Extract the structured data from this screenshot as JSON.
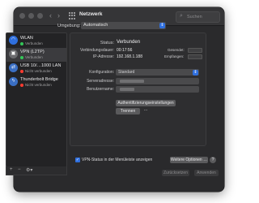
{
  "window": {
    "title": "Netzwerk",
    "search_placeholder": "Suchen"
  },
  "location": {
    "label": "Umgebung:",
    "value": "Automatisch"
  },
  "sidebar": {
    "items": [
      {
        "name": "WLAN",
        "status": "Verbunden",
        "status_color": "#34c759",
        "icon": "wifi-icon",
        "icon_color": "#2f6fde"
      },
      {
        "name": "VPN (L2TP)",
        "status": "Verbunden",
        "status_color": "#34c759",
        "icon": "lock-icon",
        "icon_color": "#6b6b6e"
      },
      {
        "name": "USB 10/…1000 LAN",
        "status": "Nicht verbunden",
        "status_color": "#ff3b30",
        "icon": "ethernet-icon",
        "icon_color": "#3a6fc4"
      },
      {
        "name": "Thunderbolt Bridge",
        "status": "Nicht verbunden",
        "status_color": "#ff3b30",
        "icon": "thunderbolt-icon",
        "icon_color": "#3a6fc4"
      }
    ],
    "add_label": "+",
    "remove_label": "−",
    "gear_label": "⚙︎▾"
  },
  "details": {
    "status_label": "Status:",
    "status_value": "Verbunden",
    "connect_time_label": "Verbindungsdauer:",
    "connect_time_value": "00:17:56",
    "ip_label": "IP-Adresse:",
    "ip_value": "192.168.1.188",
    "sent_label": "Gesendet:",
    "received_label": "Empfangen:",
    "config_label": "Konfiguration:",
    "config_value": "Standard",
    "server_label": "Serveradresse:",
    "server_value": "",
    "account_label": "Benutzername:",
    "account_value": "",
    "auth_button": "Authentifizierungseinstellungen …",
    "disconnect_button": "Trennen"
  },
  "footer": {
    "show_vpn_label": "VPN-Status in der Menüleiste anzeigen",
    "advanced_button": "Weitere Optionen …",
    "help_label": "?",
    "revert_button": "Zurücksetzen",
    "apply_button": "Anwenden"
  },
  "accent_color": "#2f6fde"
}
